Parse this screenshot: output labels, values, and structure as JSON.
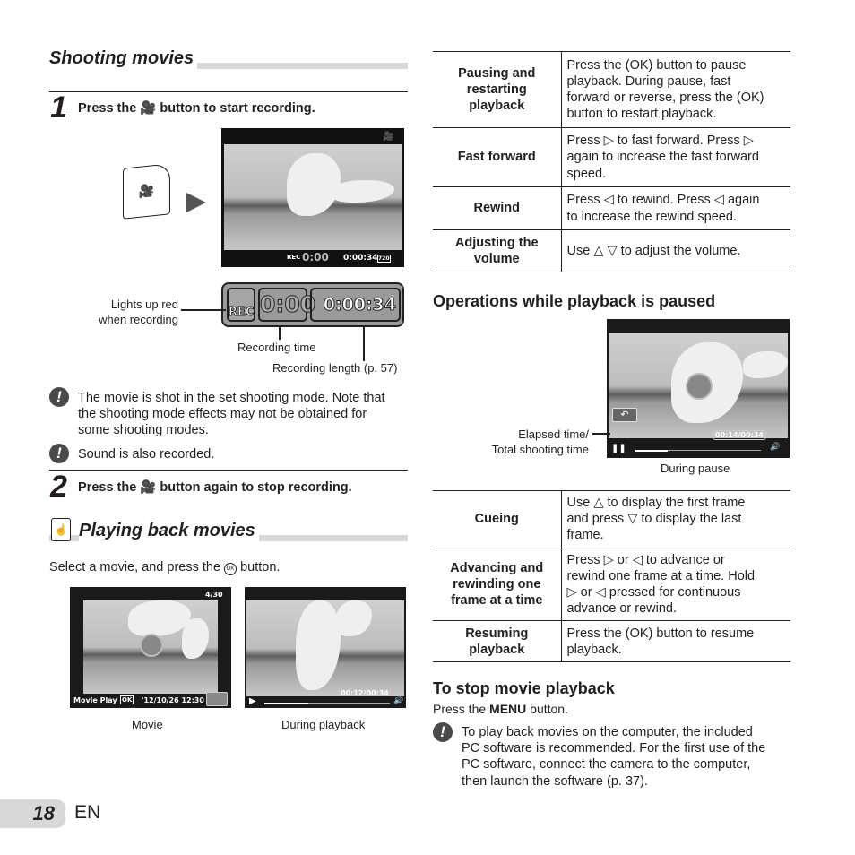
{
  "left": {
    "section1_title": "Shooting movies",
    "step1_num": "1",
    "step1_pre": "Press the",
    "step1_post": "button to start recording.",
    "screen": {
      "rec": "REC",
      "rec_time": "0:00",
      "length": "0:00:34",
      "quality": "720"
    },
    "zoom_rec": "REC",
    "zoom_time": "0:00",
    "zoom_length": "0:00:34",
    "label_lights": "Lights up red",
    "label_lights2": "when recording",
    "label_rec_time": "Recording time",
    "label_rec_length": "Recording length (p. 57)",
    "note1": [
      "The movie is shot in the set shooting mode. Note that",
      "the shooting mode effects may not be obtained for",
      "some shooting modes."
    ],
    "note2": "Sound is also recorded.",
    "step2_num": "2",
    "step2_pre": "Press the",
    "step2_post": "button again to stop recording.",
    "section2_title": "Playing back movies",
    "select_pre": "Select a movie, and press the",
    "select_post": "button.",
    "shot1": {
      "count": "4/30",
      "movie_play": "Movie Play",
      "ok": "OK",
      "date": "'12/10/26 12:30",
      "caption": "Movie"
    },
    "shot2": {
      "time": "00:12/00:34",
      "caption": "During playback"
    }
  },
  "right": {
    "table1": [
      {
        "key": "Pausing and restarting playback",
        "value": [
          "Press the (OK) button to pause",
          "playback. During pause, fast",
          "forward or reverse, press the (OK)",
          "button to restart playback."
        ]
      },
      {
        "key": "Fast forward",
        "value": [
          "Press ▷ to fast forward. Press ▷",
          "again to increase the fast forward",
          "speed."
        ]
      },
      {
        "key": "Rewind",
        "value": [
          "Press ◁ to rewind. Press ◁ again",
          "to increase the rewind speed."
        ]
      },
      {
        "key": "Adjusting the volume",
        "value": [
          "Use △ ▽ to adjust the volume."
        ]
      }
    ],
    "paused_title": "Operations while playback is paused",
    "paused_shot": {
      "time": "00:14/00:34",
      "caption": "During pause"
    },
    "label_elapsed": "Elapsed time/",
    "label_total": "Total shooting time",
    "table2": [
      {
        "key": "Cueing",
        "value": [
          "Use △ to display the first frame",
          "and press ▽ to display the last",
          "frame."
        ]
      },
      {
        "key": "Advancing and rewinding one frame at a time",
        "value": [
          "Press ▷ or ◁ to advance or",
          "rewind one frame at a time. Hold",
          "▷ or ◁ pressed for continuous",
          "advance or rewind."
        ]
      },
      {
        "key": "Resuming playback",
        "value": [
          "Press the (OK) button to resume",
          "playback."
        ]
      }
    ],
    "stop_title": "To stop movie playback",
    "stop_pre": "Press the",
    "stop_menu": "MENU",
    "stop_post": "button.",
    "note": [
      "To play back movies on the computer, the included",
      "PC software is recommended. For the first use of the",
      "PC software, connect the camera to the computer,",
      "then launch the software (p. 37)."
    ]
  },
  "footer": {
    "page": "18",
    "lang": "EN"
  }
}
